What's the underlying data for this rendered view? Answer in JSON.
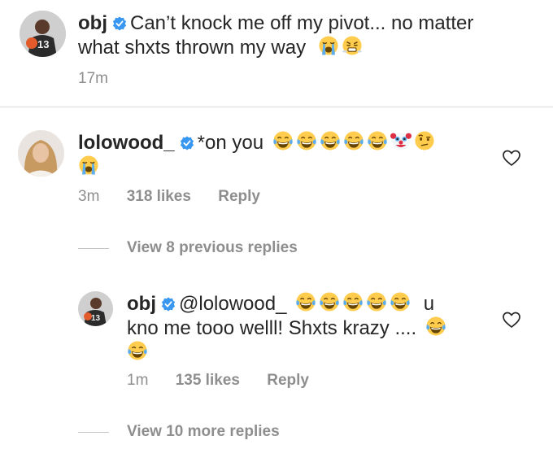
{
  "post": {
    "username": "obj",
    "verified": true,
    "caption_line1": "Can’t knock me off my pivot... no matter",
    "caption_line2": "what shxts thrown my way",
    "caption_emojis": [
      "loudly-crying-face",
      "face-with-steam-from-nose"
    ],
    "time": "17m"
  },
  "comment": {
    "username": "lolowood_",
    "verified": true,
    "text": "*on you",
    "emojis_line1": [
      "face-with-tears-of-joy",
      "face-with-tears-of-joy",
      "face-with-tears-of-joy",
      "face-with-tears-of-joy",
      "face-with-tears-of-joy",
      "clown-face",
      "face-with-raised-eyebrow"
    ],
    "emojis_line2": [
      "loudly-crying-face"
    ],
    "time": "3m",
    "likes": "318 likes",
    "reply_label": "Reply",
    "view_previous": "View 8 previous replies"
  },
  "reply": {
    "username": "obj",
    "verified": true,
    "mention": "@lolowood_",
    "text_line1_tail": "u",
    "text_line2": "kno me tooo welll! Shxts krazy ....",
    "emojis_line1": [
      "face-with-tears-of-joy",
      "face-with-tears-of-joy",
      "face-with-tears-of-joy",
      "face-with-tears-of-joy",
      "face-with-tears-of-joy"
    ],
    "emojis_line2_end": [
      "face-with-tears-of-joy"
    ],
    "emojis_line3": [
      "face-with-tears-of-joy"
    ],
    "time": "1m",
    "likes": "135 likes",
    "reply_label": "Reply",
    "view_more": "View 10 more replies"
  },
  "colors": {
    "verified_blue": "#3897f0",
    "meta_gray": "#8e8e8e",
    "text": "#262626",
    "emoji_yellow": "#ffcc4d"
  }
}
